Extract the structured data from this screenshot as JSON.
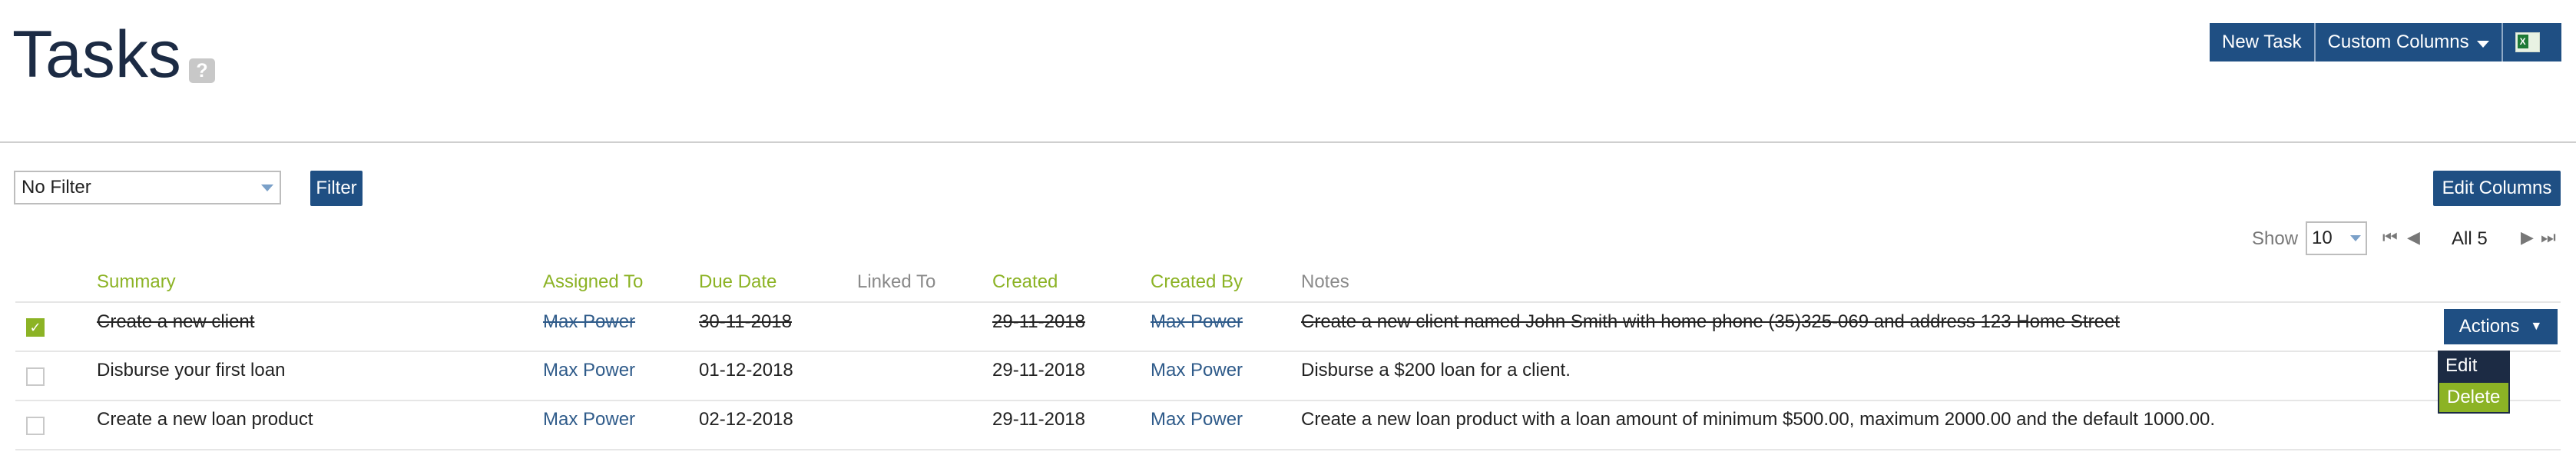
{
  "page": {
    "title": "Tasks",
    "help_icon": "?"
  },
  "toolbar": {
    "new_task_label": "New Task",
    "custom_columns_label": "Custom Columns",
    "export_icon": "excel-icon"
  },
  "filter": {
    "selected": "No Filter",
    "button_label": "Filter",
    "edit_columns_label": "Edit Columns"
  },
  "pagination": {
    "show_label": "Show",
    "page_size": "10",
    "count_label": "All 5"
  },
  "table": {
    "headers": {
      "summary": "Summary",
      "assigned_to": "Assigned To",
      "due_date": "Due Date",
      "linked_to": "Linked To",
      "created": "Created",
      "created_by": "Created By",
      "notes": "Notes"
    },
    "rows": [
      {
        "checked": true,
        "summary": "Create a new client",
        "assigned_to": "Max Power",
        "due_date": "30-11-2018",
        "linked_to": "",
        "created": "29-11-2018",
        "created_by": "Max Power",
        "notes": "Create a new client named John Smith with home phone (35)325-069 and address 123 Home Street",
        "actions_label": "Actions"
      },
      {
        "checked": false,
        "summary": "Disburse your first loan",
        "assigned_to": "Max Power",
        "due_date": "01-12-2018",
        "linked_to": "",
        "created": "29-11-2018",
        "created_by": "Max Power",
        "notes": "Disburse a $200 loan for a client."
      },
      {
        "checked": false,
        "summary": "Create a new loan product",
        "assigned_to": "Max Power",
        "due_date": "02-12-2018",
        "linked_to": "",
        "created": "29-11-2018",
        "created_by": "Max Power",
        "notes": "Create a new loan product with a loan amount of minimum $500.00, maximum 2000.00 and the default 1000.00."
      }
    ]
  },
  "actions_menu": {
    "edit_label": "Edit",
    "delete_label": "Delete"
  },
  "colors": {
    "brand_blue": "#1f4f83",
    "accent_green": "#8cb325",
    "title_navy": "#1c2b44",
    "link_blue": "#2f5b8a"
  }
}
